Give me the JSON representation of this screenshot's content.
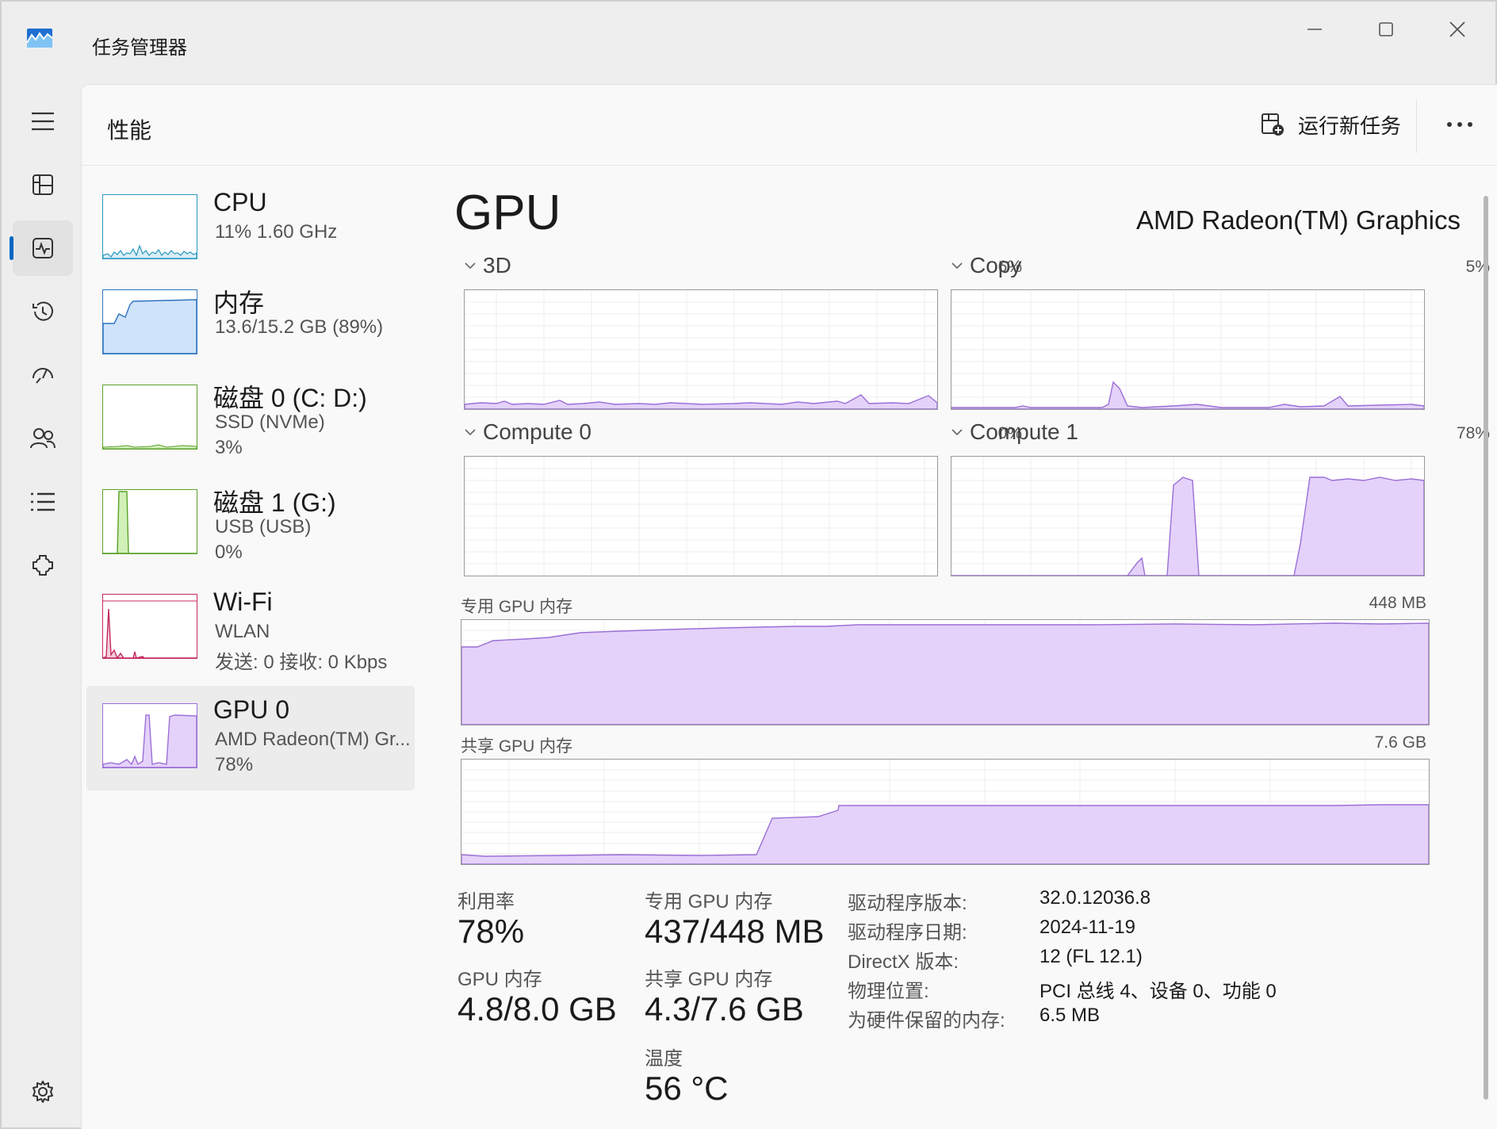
{
  "window": {
    "title": "任务管理器"
  },
  "header": {
    "page_title": "性能",
    "run_new_task": "运行新任务"
  },
  "colors": {
    "accent": "#0067c0",
    "gpu_fill": "#e4d2fa",
    "gpu_line": "#9b6fd6",
    "cpu_line": "#2a98bf",
    "mem_fill": "#cfe3fb",
    "mem_line": "#2f74c0",
    "disk1_fill": "#d1f0b8",
    "disk1_line": "#5aa12a",
    "wifi_line": "#c42a5e"
  },
  "sidebar_nav": [
    {
      "name": "menu-icon"
    },
    {
      "name": "processes-icon"
    },
    {
      "name": "performance-icon"
    },
    {
      "name": "app-history-icon"
    },
    {
      "name": "startup-apps-icon"
    },
    {
      "name": "users-icon"
    },
    {
      "name": "details-icon"
    },
    {
      "name": "services-icon"
    },
    {
      "name": "settings-icon"
    }
  ],
  "resources": [
    {
      "title": "CPU",
      "line1": "11% 1.60 GHz",
      "line2": "",
      "line3": ""
    },
    {
      "title": "内存",
      "line1": "13.6/15.2 GB (89%)",
      "line2": "",
      "line3": ""
    },
    {
      "title": "磁盘 0 (C: D:)",
      "line1": "SSD (NVMe)",
      "line2": "3%",
      "line3": ""
    },
    {
      "title": "磁盘 1 (G:)",
      "line1": "USB (USB)",
      "line2": "0%",
      "line3": ""
    },
    {
      "title": "Wi-Fi",
      "line1": "WLAN",
      "line2": "发送: 0 接收: 0 Kbps",
      "line3": ""
    },
    {
      "title": "GPU 0",
      "line1": "AMD Radeon(TM) Gr...",
      "line2": "78%",
      "line3": ""
    }
  ],
  "gpu": {
    "heading": "GPU",
    "model": "AMD Radeon(TM) Graphics",
    "engines": [
      {
        "label": "3D",
        "pct": "6%"
      },
      {
        "label": "Copy",
        "pct": "5%"
      },
      {
        "label": "Compute 0",
        "pct": "0%"
      },
      {
        "label": "Compute 1",
        "pct": "78%"
      }
    ],
    "dedicated_mem": {
      "label": "专用 GPU 内存",
      "max": "448 MB"
    },
    "shared_mem": {
      "label": "共享 GPU 内存",
      "max": "7.6 GB"
    },
    "stats": {
      "utilization": {
        "label": "利用率",
        "value": "78%"
      },
      "dedicated": {
        "label": "专用 GPU 内存",
        "value": "437/448 MB"
      },
      "gpu_memory": {
        "label": "GPU 内存",
        "value": "4.8/8.0 GB"
      },
      "shared": {
        "label": "共享 GPU 内存",
        "value": "4.3/7.6 GB"
      },
      "temperature": {
        "label": "温度",
        "value": "56 °C"
      }
    },
    "properties": [
      {
        "label": "驱动程序版本:",
        "value": "32.0.12036.8"
      },
      {
        "label": "驱动程序日期:",
        "value": "2024-11-19"
      },
      {
        "label": "DirectX 版本:",
        "value": "12 (FL 12.1)"
      },
      {
        "label": "物理位置:",
        "value": "PCI 总线 4、设备 0、功能 0"
      },
      {
        "label": "为硬件保留的内存:",
        "value": "6.5 MB"
      }
    ]
  }
}
